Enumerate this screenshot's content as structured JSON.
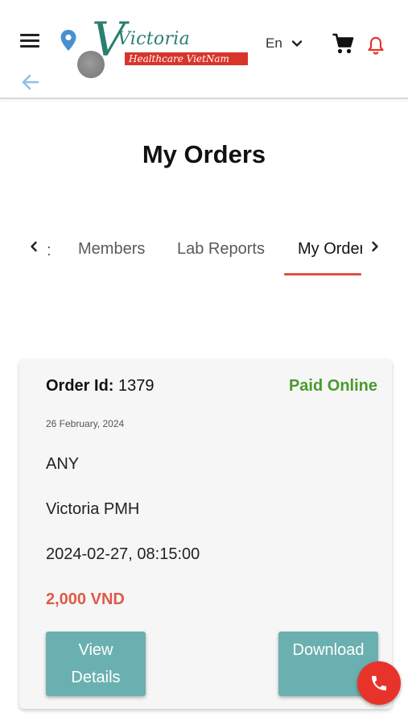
{
  "header": {
    "logo": {
      "name": "Victoria",
      "tagline": "Healthcare VietNam"
    },
    "language": "En"
  },
  "page": {
    "title": "My Orders"
  },
  "tabs": {
    "partial_left": ":",
    "items": [
      {
        "label": "Members"
      },
      {
        "label": "Lab Reports"
      },
      {
        "label": "My Orders"
      }
    ],
    "active_index": 2
  },
  "order": {
    "id_label": "Order Id:",
    "id_value": "1379",
    "payment_status": "Paid Online",
    "date": "26 February, 2024",
    "type": "ANY",
    "location": "Victoria PMH",
    "appointment": "2024-02-27, 08:15:00",
    "amount": "2,000 VND",
    "view_label_line1": "View",
    "view_label_line2": "Details",
    "download_label": "Download"
  },
  "colors": {
    "accent_red": "#e8332b",
    "brand_teal": "#2a7f6f",
    "button_teal": "#6bb0b0",
    "paid_green": "#4a9a2e",
    "price_red": "#de5a48"
  },
  "icons": [
    "menu-icon",
    "location-pin-icon",
    "chevron-down-icon",
    "cart-icon",
    "bell-icon",
    "back-arrow-icon",
    "chevron-left-icon",
    "chevron-right-icon",
    "phone-icon"
  ]
}
